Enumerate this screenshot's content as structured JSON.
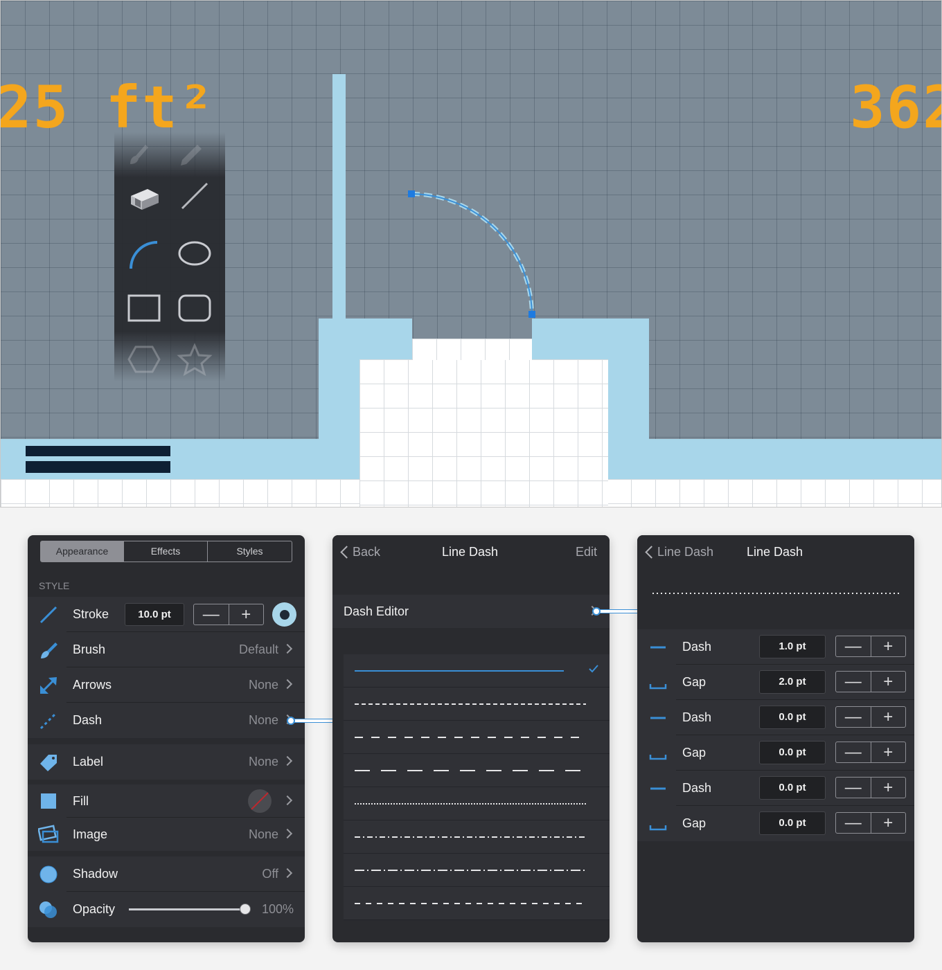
{
  "canvas": {
    "area_left": "25 ft²",
    "area_right": "362",
    "tools": [
      "brush-tool",
      "pencil-tool",
      "eraser-tool",
      "line-tool",
      "arc-tool",
      "ellipse-tool",
      "rectangle-tool",
      "rounded-rectangle-tool",
      "polygon-tool",
      "star-tool"
    ],
    "colors": {
      "grid_bg": "#7d8b97",
      "wall": "#a8d6ea",
      "area_text": "#f4a61d",
      "selection": "#3a8fd6"
    }
  },
  "appearance_panel": {
    "tabs": [
      "Appearance",
      "Effects",
      "Styles"
    ],
    "active_tab": "Appearance",
    "section_title": "STYLE",
    "stroke": {
      "label": "Stroke",
      "value": "10.0 pt"
    },
    "brush": {
      "label": "Brush",
      "value": "Default"
    },
    "arrows": {
      "label": "Arrows",
      "value": "None"
    },
    "dash": {
      "label": "Dash",
      "value": "None"
    },
    "label_row": {
      "label": "Label",
      "value": "None"
    },
    "fill": {
      "label": "Fill"
    },
    "image": {
      "label": "Image",
      "value": "None"
    },
    "shadow": {
      "label": "Shadow",
      "value": "Off"
    },
    "opacity": {
      "label": "Opacity",
      "value": "100%",
      "level": 1.0
    }
  },
  "line_dash_panel": {
    "back_label": "Back",
    "title": "Line Dash",
    "edit_label": "Edit",
    "dash_editor_label": "Dash Editor",
    "selected_index": 0,
    "patterns": [
      {
        "name": "solid"
      },
      {
        "name": "short-dash"
      },
      {
        "name": "medium-dash"
      },
      {
        "name": "long-dash"
      },
      {
        "name": "dotted"
      },
      {
        "name": "dash-dot"
      },
      {
        "name": "long-dash-dot"
      },
      {
        "name": "dash-spaced"
      }
    ]
  },
  "dash_editor_panel": {
    "back_label": "Line Dash",
    "title": "Line Dash",
    "rows": [
      {
        "label": "Dash",
        "value": "1.0 pt",
        "icon": "dash-segment-icon"
      },
      {
        "label": "Gap",
        "value": "2.0 pt",
        "icon": "gap-segment-icon"
      },
      {
        "label": "Dash",
        "value": "0.0 pt",
        "icon": "dash-segment-icon"
      },
      {
        "label": "Gap",
        "value": "0.0 pt",
        "icon": "gap-segment-icon"
      },
      {
        "label": "Dash",
        "value": "0.0 pt",
        "icon": "dash-segment-icon"
      },
      {
        "label": "Gap",
        "value": "0.0 pt",
        "icon": "gap-segment-icon"
      }
    ]
  },
  "stepper": {
    "minus": "—",
    "plus": "+"
  }
}
